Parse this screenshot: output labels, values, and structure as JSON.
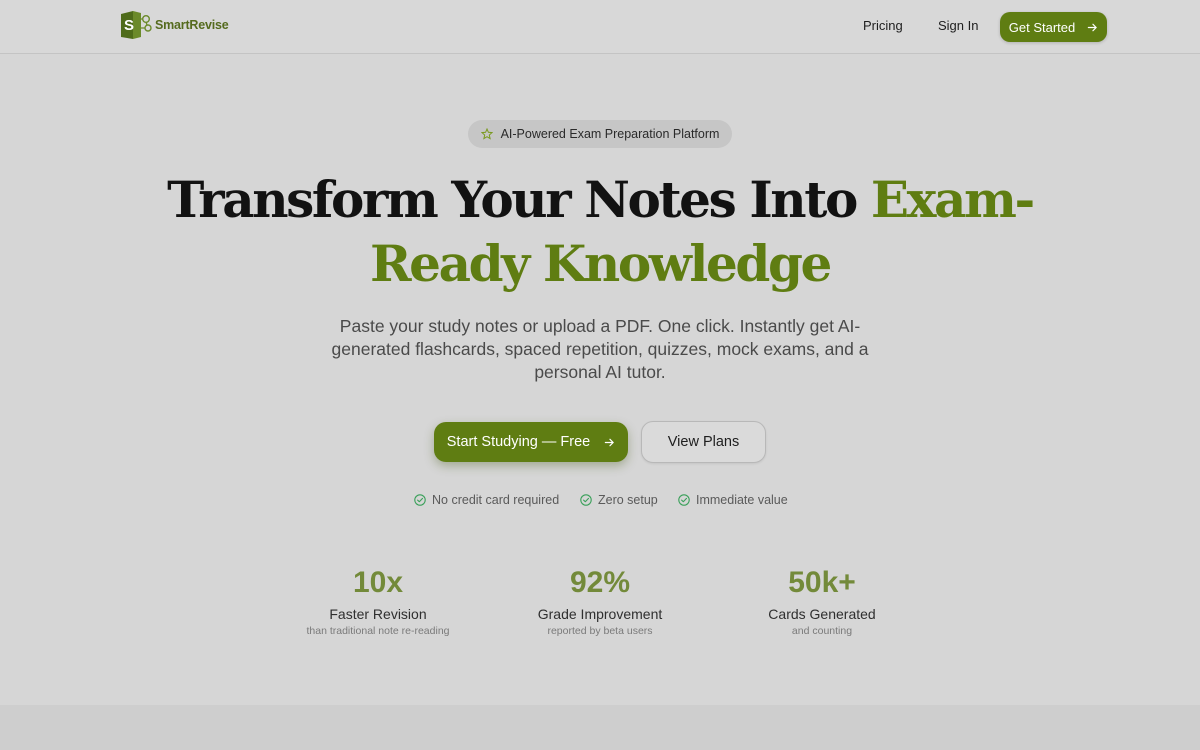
{
  "brand": {
    "name": "SmartRevise",
    "mark_letter": "S",
    "color": "#5f7d12"
  },
  "nav": {
    "links": [
      {
        "label": "Pricing"
      },
      {
        "label": "Sign In"
      }
    ],
    "cta_label": "Get Started"
  },
  "hero": {
    "badge": "AI-Powered Exam Preparation Platform",
    "headline_plain": "Transform Your Notes Into ",
    "headline_accent_1": "Exam-",
    "headline_accent_2": "Ready Knowledge",
    "subtitle": "Paste your study notes or upload a PDF. One click. Instantly get AI-generated flashcards, spaced repetition, quizzes, mock exams, and a personal AI tutor.",
    "primary_cta": "Start Studying — Free",
    "secondary_cta": "View Plans"
  },
  "checks": [
    {
      "label": "No credit card required"
    },
    {
      "label": "Zero setup"
    },
    {
      "label": "Immediate value"
    }
  ],
  "stats": [
    {
      "value": "10x",
      "label": "Faster Revision",
      "sub": "than traditional note re-reading"
    },
    {
      "value": "92%",
      "label": "Grade Improvement",
      "sub": "reported by beta users"
    },
    {
      "value": "50k+",
      "label": "Cards Generated",
      "sub": "and counting"
    }
  ],
  "colors": {
    "accent": "#5f7d12",
    "stat": "#738a3a",
    "check": "#3aa05a"
  }
}
